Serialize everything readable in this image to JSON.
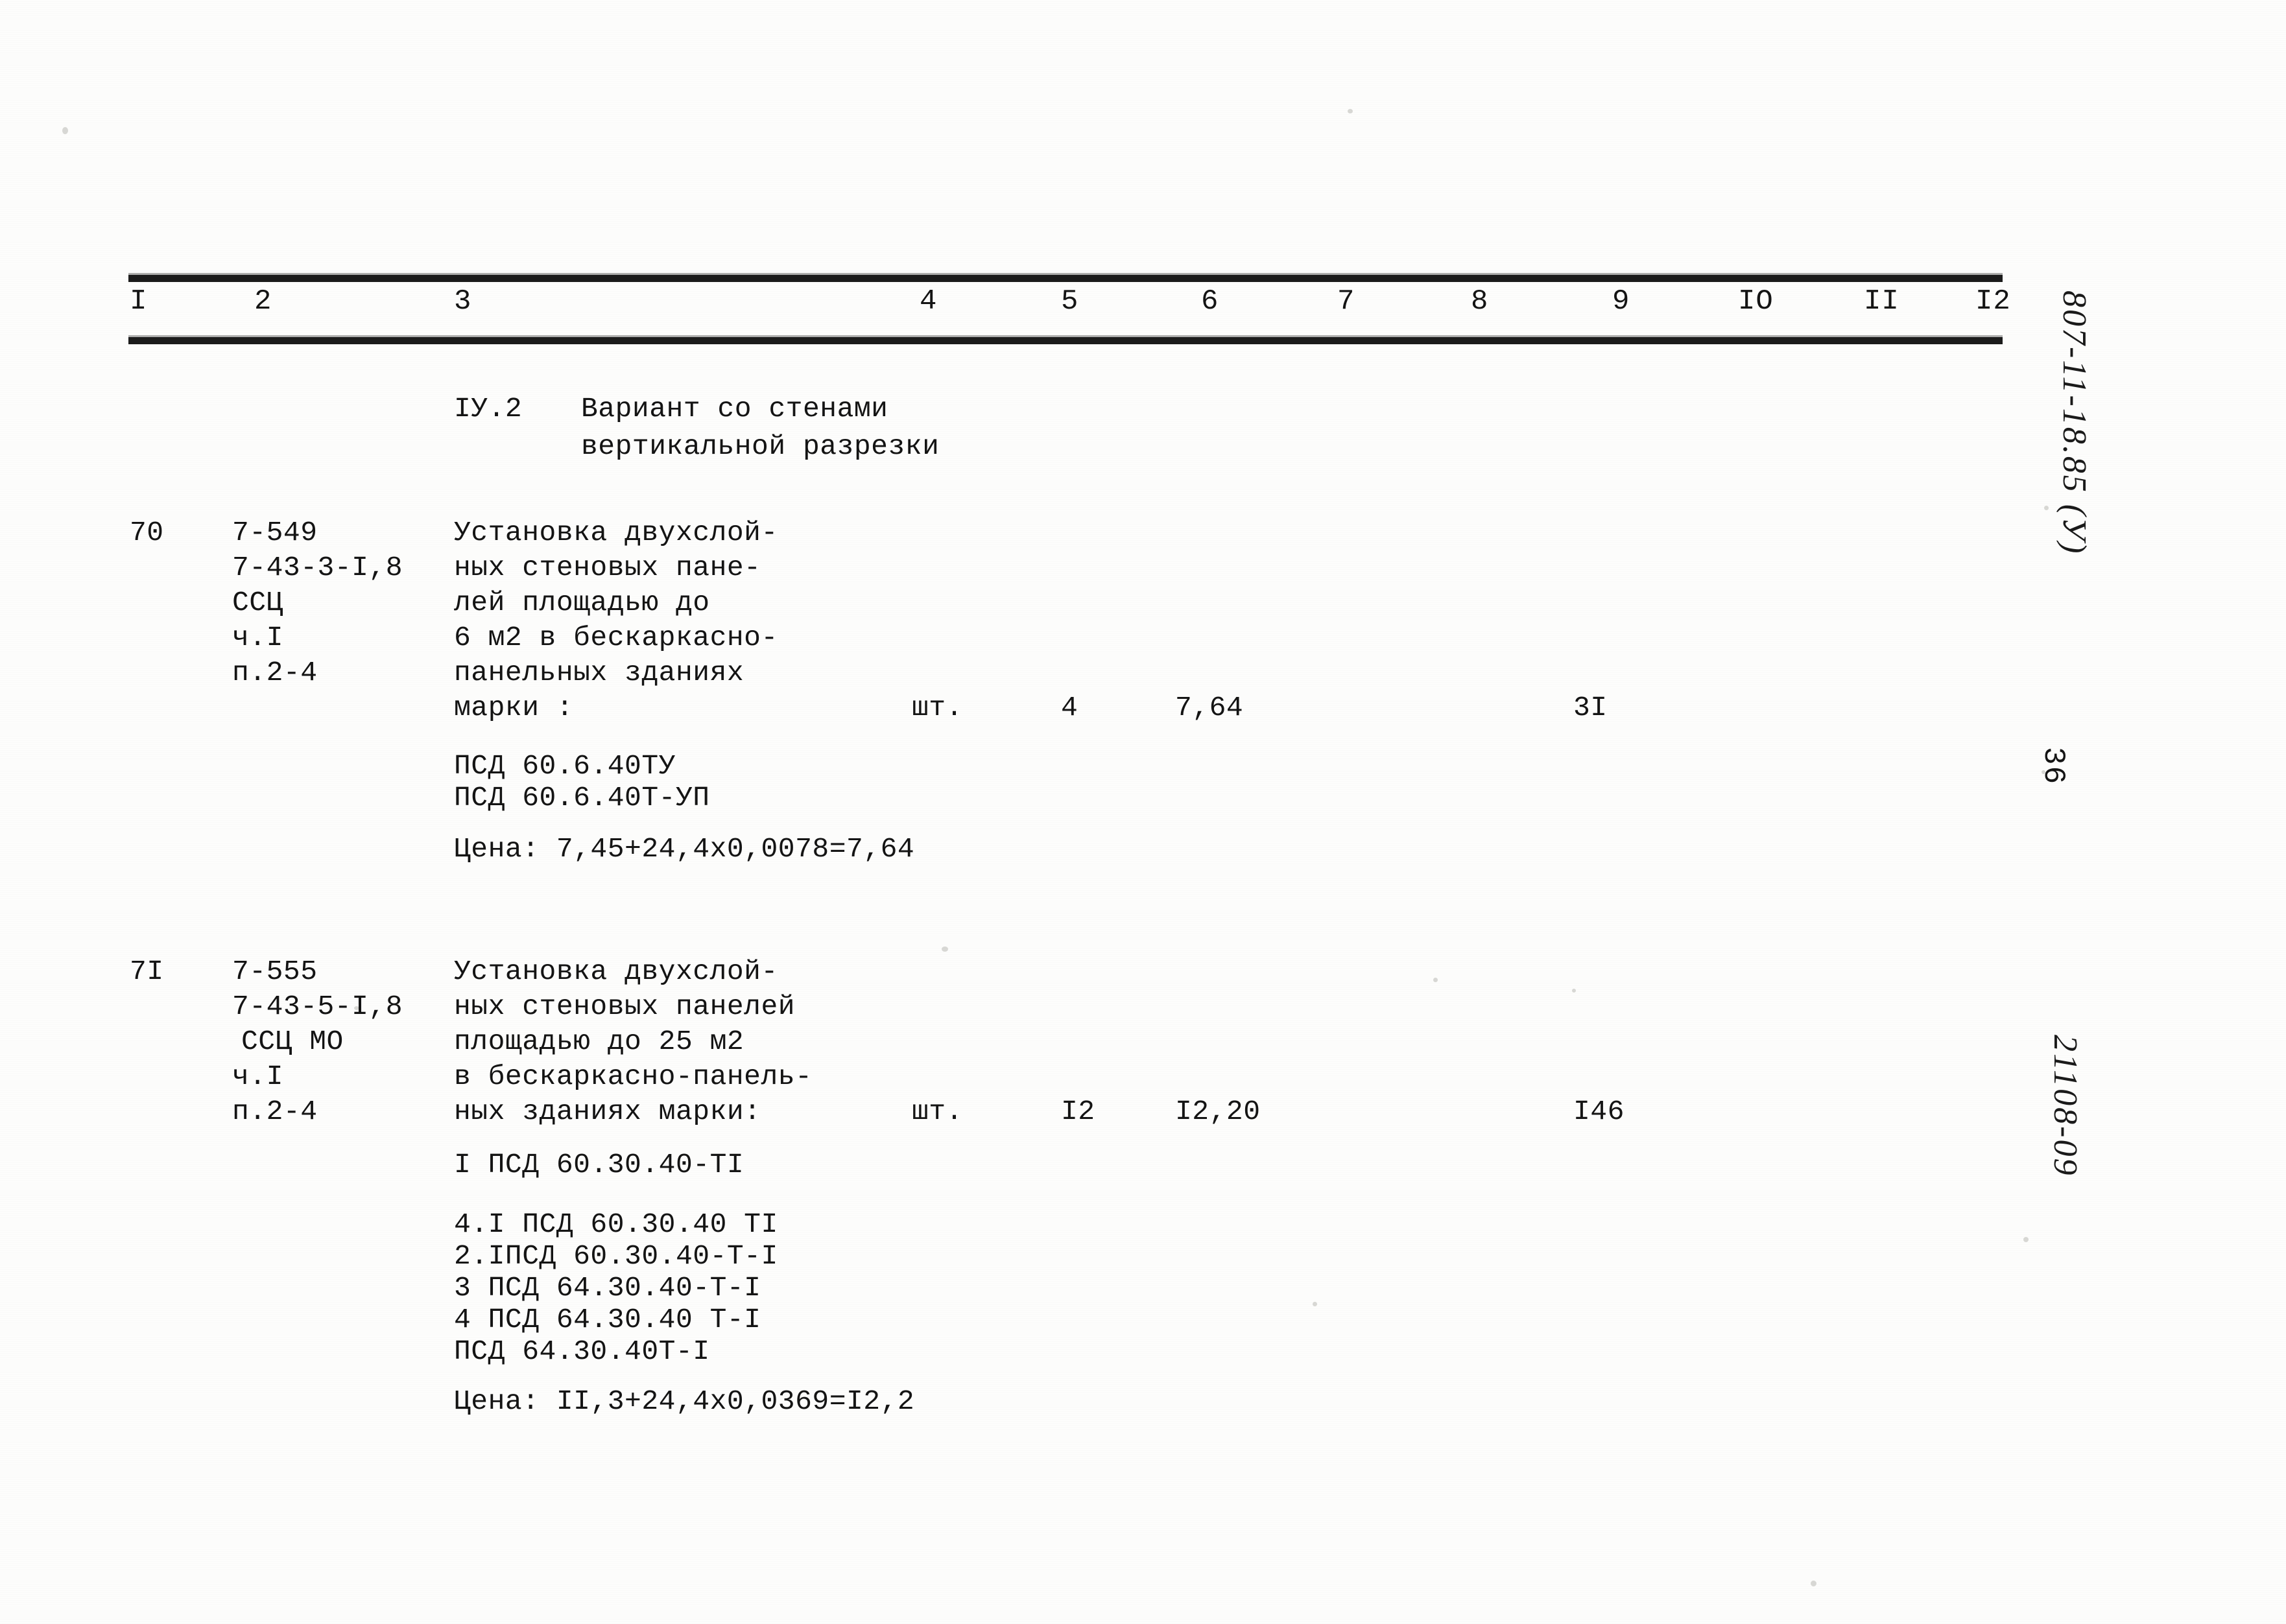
{
  "document": {
    "type": "scanned-price-table",
    "language": "ru"
  },
  "table": {
    "column_headers": [
      "I",
      "2",
      "3",
      "4",
      "5",
      "6",
      "7",
      "8",
      "9",
      "IO",
      "II",
      "I2"
    ]
  },
  "section": {
    "number": "IУ.2",
    "title_line1": "Вариант со стенами",
    "title_line2": "вертикальной разрезки"
  },
  "rows": [
    {
      "num": "70",
      "codes": [
        "7-549",
        "7-43-3-I,8",
        "ССЦ",
        "ч.I",
        "п.2-4"
      ],
      "description": [
        "Установка двухслой-",
        "ных стеновых пане-",
        "лей площадью до",
        "6 м2 в бескаркасно-",
        "панельных зданиях",
        "марки :"
      ],
      "unit": "шт.",
      "qty": "4",
      "price": "7,64",
      "total": "3I",
      "marks": [
        "ПСД 60.6.40ТУ",
        "ПСД 60.6.40Т-УП"
      ],
      "formula": "Цена: 7,45+24,4х0,0078=7,64"
    },
    {
      "num": "7I",
      "codes": [
        "7-555",
        "7-43-5-I,8",
        "ССЦ МО",
        "ч.I",
        "п.2-4"
      ],
      "description": [
        "Установка двухслой-",
        "ных стеновых панелей",
        "площадью до 25 м2",
        "в бескаркасно-панель-",
        "ных зданиях марки:"
      ],
      "unit": "шт.",
      "qty": "I2",
      "price": "I2,20",
      "total": "I46",
      "marks_first": "I ПСД 60.30.40-ТI",
      "marks": [
        "4.I ПСД 60.30.40 ТI",
        "2.IПСД 60.30.40-Т-I",
        "3 ПСД 64.30.40-Т-I",
        "4 ПСД 64.30.40 Т-I",
        "ПСД 64.30.40Т-I"
      ],
      "formula": "Цена: II,3+24,4х0,0369=I2,2"
    }
  ],
  "margin": {
    "stamp_top": "807-11-18.85 (У)",
    "page_number": "36",
    "stamp_bottom": "21108-09"
  }
}
